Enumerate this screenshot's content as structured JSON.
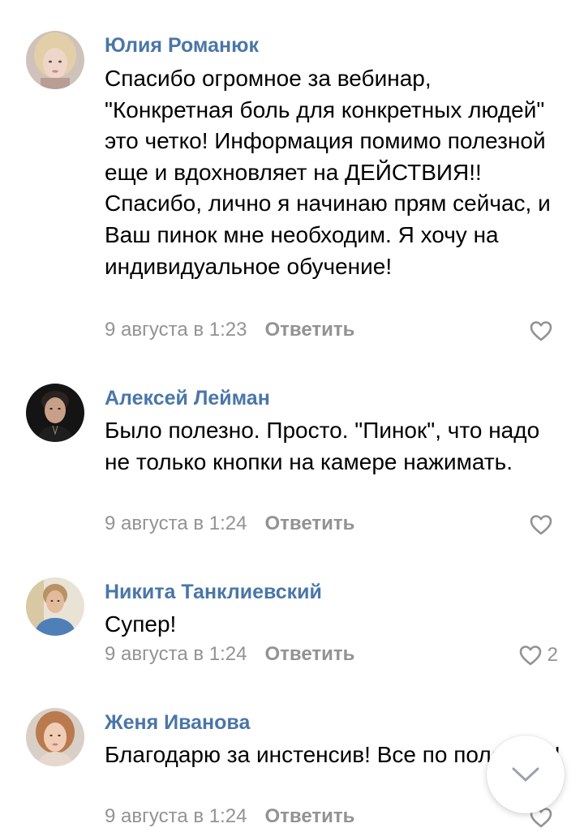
{
  "colors": {
    "author": "#4a76a8",
    "meta": "#939393",
    "text": "#000000"
  },
  "comments": [
    {
      "author": "Юлия Романюк",
      "text": "Спасибо огромное за вебинар, \"Конкретная боль для конкретных людей\" это четко! Информация помимо полезной еще и вдохновляет на ДЕЙСТВИЯ!! Спасибо, лично я начинаю прям сейчас, и Ваш пинок мне необходим. Я хочу на индивидуальное обучение!",
      "date": "9 августа в 1:23",
      "reply_label": "Ответить",
      "likes": "",
      "like_icon": "heart-outline-icon"
    },
    {
      "author": "Алексей Лейман",
      "text": "Было полезно. Просто. \"Пинок\", что надо не только кнопки на камере нажимать.",
      "date": "9 августа в 1:24",
      "reply_label": "Ответить",
      "likes": "",
      "like_icon": "heart-outline-icon"
    },
    {
      "author": "Никита Танклиевский",
      "text": "Супер!",
      "date": "9 августа в 1:24",
      "reply_label": "Ответить",
      "likes": "2",
      "like_icon": "heart-outline-icon"
    },
    {
      "author": "Женя Иванова",
      "text": "Благодарю за инстенсив! Все по полочкам!",
      "date": "9 августа в 1:24",
      "reply_label": "Ответить",
      "likes": "",
      "like_icon": "heart-outline-icon"
    }
  ],
  "scroll_button": {
    "icon": "chevron-down-icon"
  }
}
